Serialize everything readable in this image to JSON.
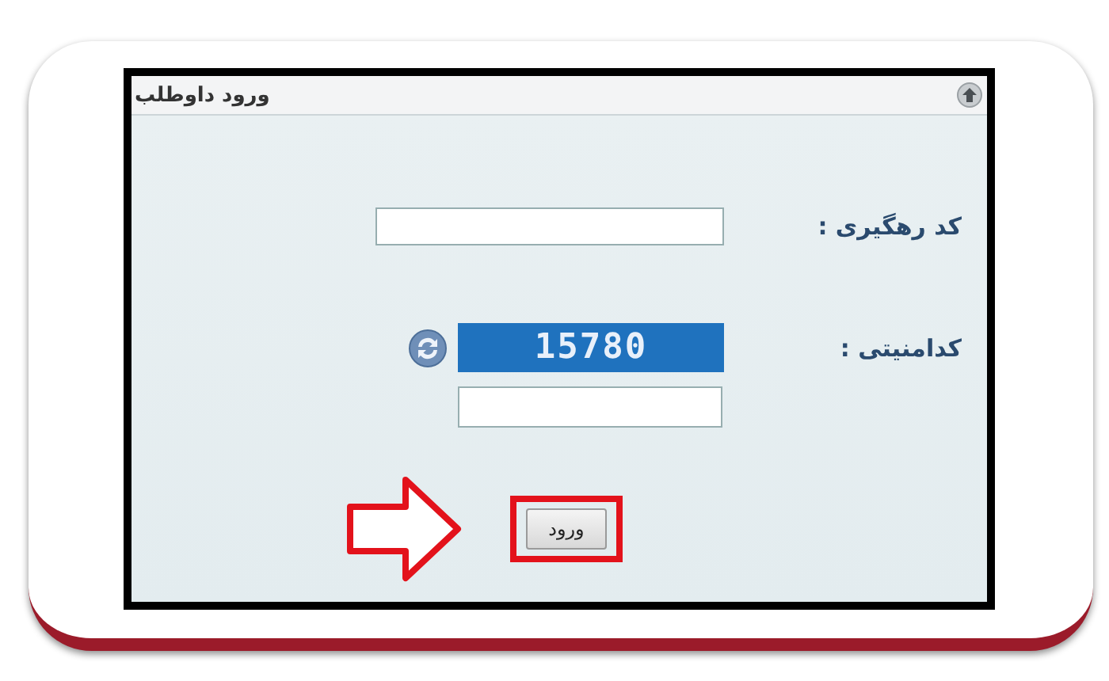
{
  "panel": {
    "title": "ورود داوطلب"
  },
  "fields": [
    {
      "kind": "text",
      "label": "کد رهگیری :"
    },
    {
      "kind": "captcha",
      "label": "کدامنیتی :",
      "captcha_code": "15780"
    }
  ],
  "submit_button": {
    "label": "ورود",
    "highlighted": true
  }
}
